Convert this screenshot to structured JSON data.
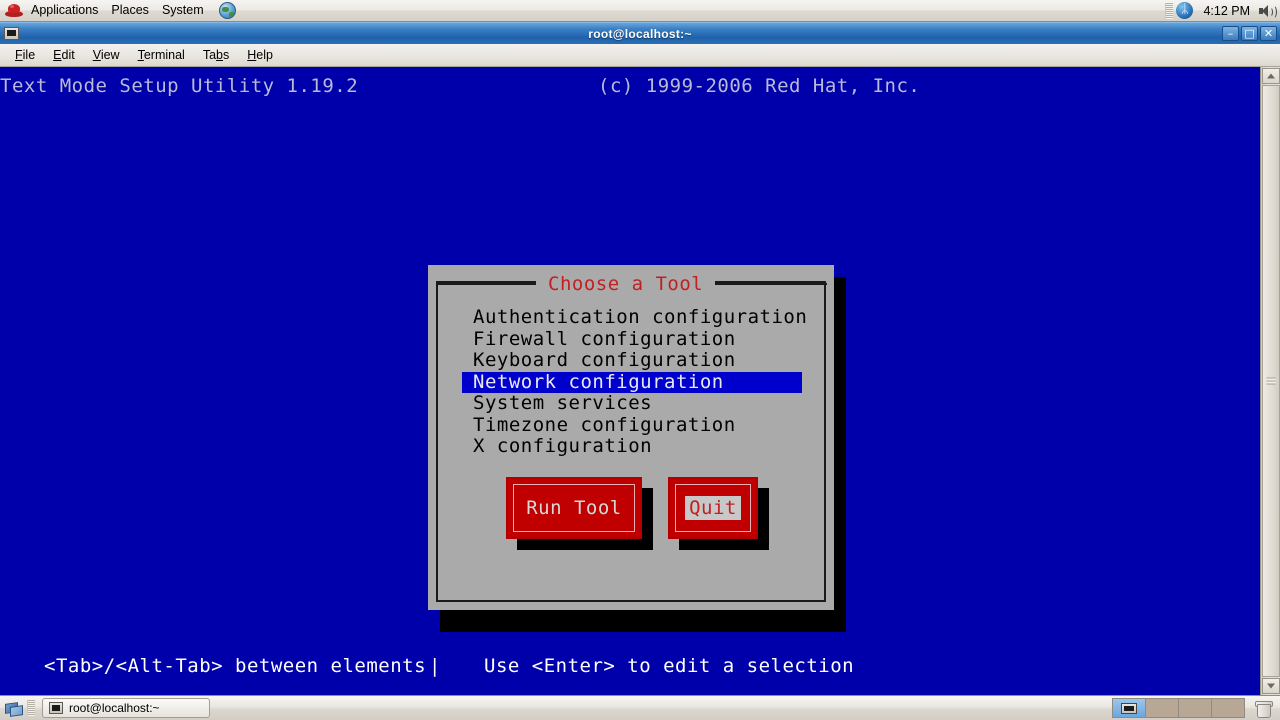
{
  "top_panel": {
    "logo_icon": "redhat-logo-icon",
    "menus": [
      {
        "label": "Applications"
      },
      {
        "label": "Places"
      },
      {
        "label": "System"
      }
    ],
    "globe_icon": "globe-icon",
    "bluetooth_icon": "bluetooth-icon",
    "bluetooth_glyph": "ᛦ",
    "clock": "4:12 PM",
    "volume_icon": "volume-icon"
  },
  "window": {
    "title": "root@localhost:~",
    "icon": "terminal-icon",
    "buttons": {
      "minimize": "–",
      "maximize": "□",
      "close": "✕"
    },
    "menu_bar": [
      {
        "accel": "F",
        "rest": "ile"
      },
      {
        "accel": "E",
        "rest": "dit"
      },
      {
        "accel": "V",
        "rest": "iew"
      },
      {
        "accel": "T",
        "rest": "erminal"
      },
      {
        "accel": "b",
        "rest": "",
        "pre": "Ta",
        "post": "s"
      },
      {
        "accel": "H",
        "rest": "elp"
      }
    ]
  },
  "terminal": {
    "header_left": "Text Mode Setup Utility 1.19.2",
    "header_right": "(c) 1999-2006 Red Hat, Inc.",
    "footer_left": "<Tab>/<Alt-Tab> between elements",
    "footer_separator": "|",
    "footer_right": "Use <Enter> to edit a selection",
    "background_color": "#0000aa",
    "text_color": "#b9b9d8"
  },
  "dialog": {
    "title": "Choose a Tool",
    "title_color": "#c22020",
    "background_color": "#aaaaaa",
    "selection_color": "#0000cc",
    "items": [
      {
        "label": "Authentication configuration",
        "selected": false
      },
      {
        "label": "Firewall configuration",
        "selected": false
      },
      {
        "label": "Keyboard configuration",
        "selected": false
      },
      {
        "label": "Network configuration",
        "selected": true
      },
      {
        "label": "System services",
        "selected": false
      },
      {
        "label": "Timezone configuration",
        "selected": false
      },
      {
        "label": "X configuration",
        "selected": false
      }
    ],
    "buttons": [
      {
        "label": "Run Tool",
        "focused": false,
        "color": "#c00000"
      },
      {
        "label": "Quit",
        "focused": true,
        "color": "#c00000"
      }
    ]
  },
  "scrollbar": {
    "up_arrow_icon": "scroll-up-arrow-icon",
    "down_arrow_icon": "scroll-down-arrow-icon"
  },
  "bottom_panel": {
    "show_desktop_icon": "show-desktop-icon",
    "task_button": {
      "label": "root@localhost:~",
      "icon": "terminal-icon"
    },
    "workspaces": [
      {
        "active": true,
        "has_window": true
      },
      {
        "active": false,
        "has_window": false
      },
      {
        "active": false,
        "has_window": false
      },
      {
        "active": false,
        "has_window": false
      }
    ],
    "trash_icon": "trash-icon"
  }
}
